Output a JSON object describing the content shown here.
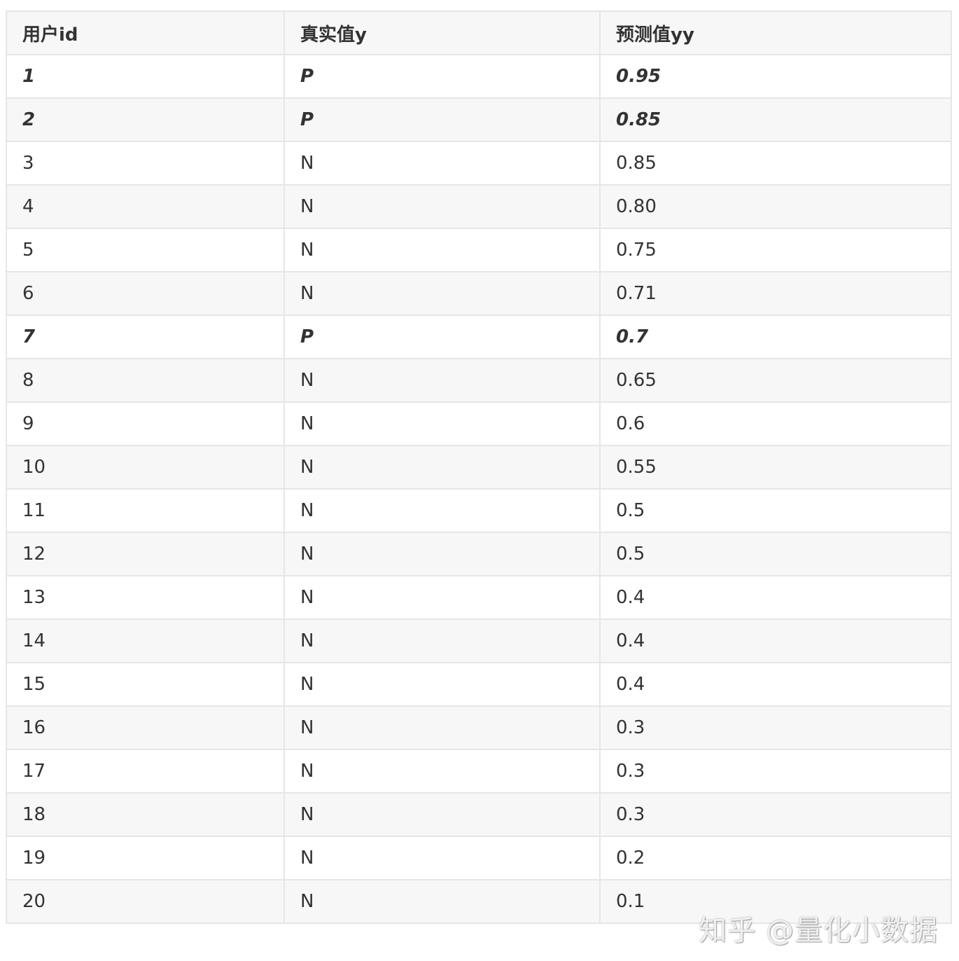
{
  "table": {
    "headers": [
      "用户id",
      "真实值y",
      "预测值yy"
    ],
    "rows": [
      {
        "id": "1",
        "y": "P",
        "yy": "0.95",
        "emphasis": true
      },
      {
        "id": "2",
        "y": "P",
        "yy": "0.85",
        "emphasis": true
      },
      {
        "id": "3",
        "y": "N",
        "yy": "0.85",
        "emphasis": false
      },
      {
        "id": "4",
        "y": "N",
        "yy": "0.80",
        "emphasis": false
      },
      {
        "id": "5",
        "y": "N",
        "yy": "0.75",
        "emphasis": false
      },
      {
        "id": "6",
        "y": "N",
        "yy": "0.71",
        "emphasis": false
      },
      {
        "id": "7",
        "y": "P",
        "yy": "0.7",
        "emphasis": true
      },
      {
        "id": "8",
        "y": "N",
        "yy": "0.65",
        "emphasis": false
      },
      {
        "id": "9",
        "y": "N",
        "yy": "0.6",
        "emphasis": false
      },
      {
        "id": "10",
        "y": "N",
        "yy": "0.55",
        "emphasis": false
      },
      {
        "id": "11",
        "y": "N",
        "yy": "0.5",
        "emphasis": false
      },
      {
        "id": "12",
        "y": "N",
        "yy": "0.5",
        "emphasis": false
      },
      {
        "id": "13",
        "y": "N",
        "yy": "0.4",
        "emphasis": false
      },
      {
        "id": "14",
        "y": "N",
        "yy": "0.4",
        "emphasis": false
      },
      {
        "id": "15",
        "y": "N",
        "yy": "0.4",
        "emphasis": false
      },
      {
        "id": "16",
        "y": "N",
        "yy": "0.3",
        "emphasis": false
      },
      {
        "id": "17",
        "y": "N",
        "yy": "0.3",
        "emphasis": false
      },
      {
        "id": "18",
        "y": "N",
        "yy": "0.3",
        "emphasis": false
      },
      {
        "id": "19",
        "y": "N",
        "yy": "0.2",
        "emphasis": false
      },
      {
        "id": "20",
        "y": "N",
        "yy": "0.1",
        "emphasis": false
      }
    ]
  },
  "watermark": "知乎 @量化小数据"
}
